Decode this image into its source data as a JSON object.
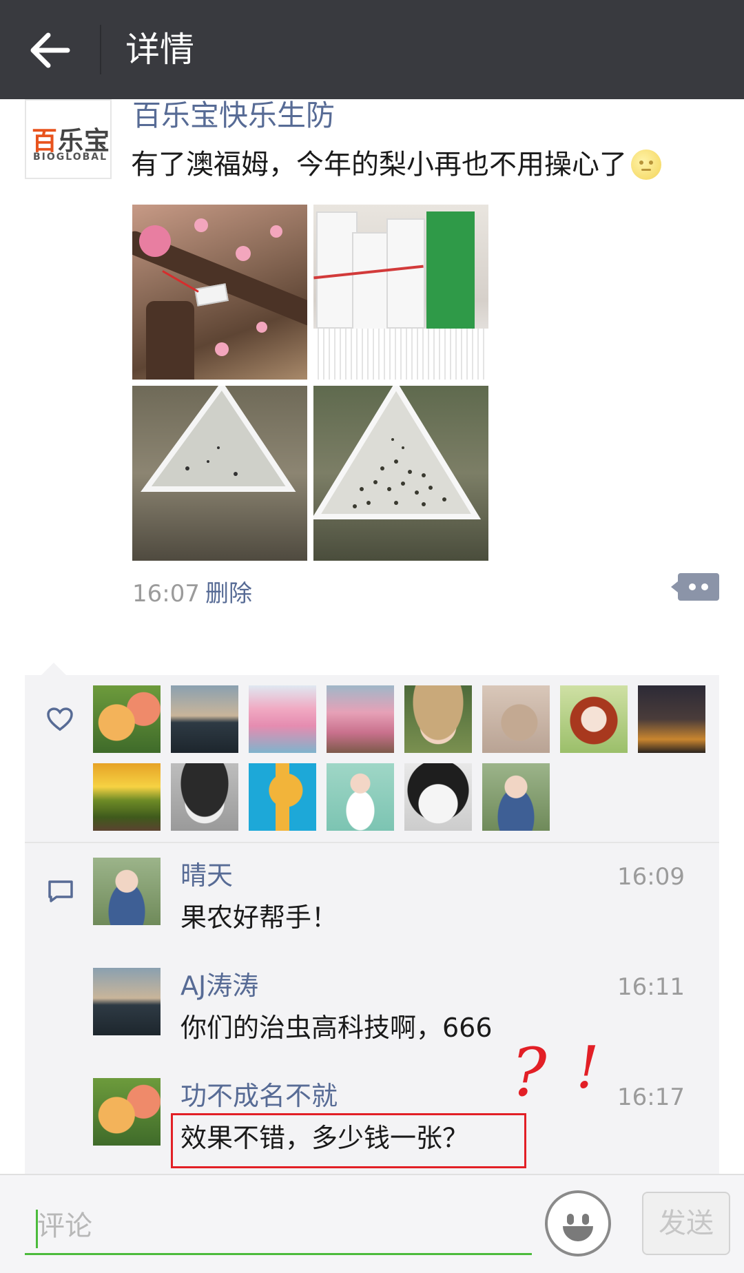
{
  "topbar": {
    "title": "详情"
  },
  "post": {
    "author": "百乐宝快乐生防",
    "avatar_logo_cn": "百乐宝",
    "avatar_logo_en": "BIOGLOBAL",
    "text": "有了澳福姆，今年的梨小再也不用操心了",
    "emoji": "moon-face",
    "photos": [
      "peach-blossom-branch-trap",
      "pheromone-lure-packages",
      "triangle-trap-few-insects",
      "triangle-trap-many-insects"
    ],
    "time": "16:07",
    "delete_label": "删除"
  },
  "likes": {
    "count": 14,
    "avatars": [
      "peaches",
      "lake-sunset",
      "pink-trees",
      "peach-orchard",
      "girl-hat",
      "cat",
      "redhair-girl-illustration",
      "city-night",
      "sunrise-field",
      "boy-hat-cartoon",
      "giraffe-cartoon",
      "flower-girl-illustration",
      "husky-dog",
      "girl-overalls"
    ]
  },
  "comments": [
    {
      "name": "晴天",
      "time": "16:09",
      "text": "果农好帮手！",
      "avatar": "girl-overalls"
    },
    {
      "name": "AJ涛涛",
      "time": "16:11",
      "text": "你们的治虫高科技啊，666",
      "avatar": "lake-sunset"
    },
    {
      "name": "功不成名不就",
      "time": "16:17",
      "text": "效果不错，多少钱一张？",
      "avatar": "peaches"
    }
  ],
  "annotation": {
    "question_mark": "?",
    "exclamation_mark": "!",
    "color": "#e21f26"
  },
  "bottom": {
    "placeholder": "评论",
    "send_label": "发送"
  },
  "colors": {
    "topbar": "#393a3f",
    "link": "#576b95",
    "input_accent": "#4cbb3c",
    "panel": "#f3f3f5"
  }
}
